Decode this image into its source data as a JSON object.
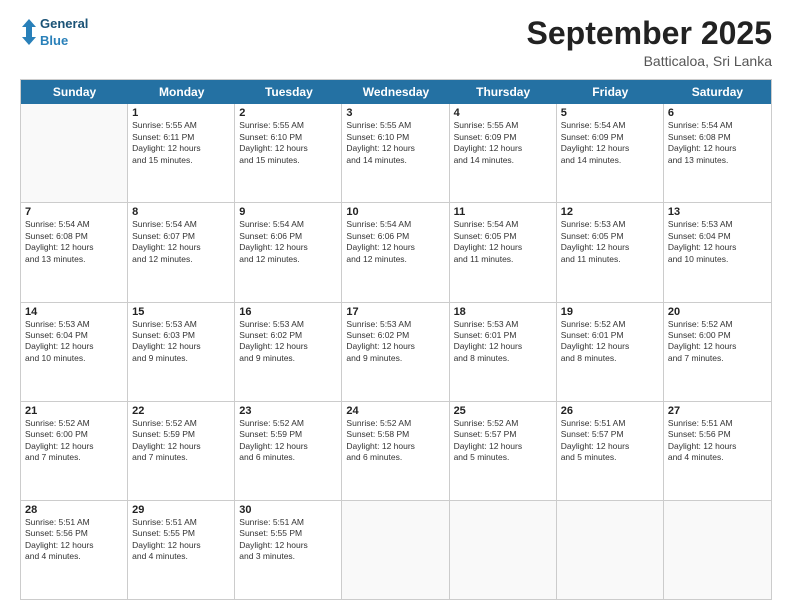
{
  "header": {
    "logo_line1": "General",
    "logo_line2": "Blue",
    "month_title": "September 2025",
    "location": "Batticaloa, Sri Lanka"
  },
  "days_of_week": [
    "Sunday",
    "Monday",
    "Tuesday",
    "Wednesday",
    "Thursday",
    "Friday",
    "Saturday"
  ],
  "weeks": [
    [
      {
        "day": "",
        "info": ""
      },
      {
        "day": "1",
        "info": "Sunrise: 5:55 AM\nSunset: 6:11 PM\nDaylight: 12 hours\nand 15 minutes."
      },
      {
        "day": "2",
        "info": "Sunrise: 5:55 AM\nSunset: 6:10 PM\nDaylight: 12 hours\nand 15 minutes."
      },
      {
        "day": "3",
        "info": "Sunrise: 5:55 AM\nSunset: 6:10 PM\nDaylight: 12 hours\nand 14 minutes."
      },
      {
        "day": "4",
        "info": "Sunrise: 5:55 AM\nSunset: 6:09 PM\nDaylight: 12 hours\nand 14 minutes."
      },
      {
        "day": "5",
        "info": "Sunrise: 5:54 AM\nSunset: 6:09 PM\nDaylight: 12 hours\nand 14 minutes."
      },
      {
        "day": "6",
        "info": "Sunrise: 5:54 AM\nSunset: 6:08 PM\nDaylight: 12 hours\nand 13 minutes."
      }
    ],
    [
      {
        "day": "7",
        "info": "Sunrise: 5:54 AM\nSunset: 6:08 PM\nDaylight: 12 hours\nand 13 minutes."
      },
      {
        "day": "8",
        "info": "Sunrise: 5:54 AM\nSunset: 6:07 PM\nDaylight: 12 hours\nand 12 minutes."
      },
      {
        "day": "9",
        "info": "Sunrise: 5:54 AM\nSunset: 6:06 PM\nDaylight: 12 hours\nand 12 minutes."
      },
      {
        "day": "10",
        "info": "Sunrise: 5:54 AM\nSunset: 6:06 PM\nDaylight: 12 hours\nand 12 minutes."
      },
      {
        "day": "11",
        "info": "Sunrise: 5:54 AM\nSunset: 6:05 PM\nDaylight: 12 hours\nand 11 minutes."
      },
      {
        "day": "12",
        "info": "Sunrise: 5:53 AM\nSunset: 6:05 PM\nDaylight: 12 hours\nand 11 minutes."
      },
      {
        "day": "13",
        "info": "Sunrise: 5:53 AM\nSunset: 6:04 PM\nDaylight: 12 hours\nand 10 minutes."
      }
    ],
    [
      {
        "day": "14",
        "info": "Sunrise: 5:53 AM\nSunset: 6:04 PM\nDaylight: 12 hours\nand 10 minutes."
      },
      {
        "day": "15",
        "info": "Sunrise: 5:53 AM\nSunset: 6:03 PM\nDaylight: 12 hours\nand 9 minutes."
      },
      {
        "day": "16",
        "info": "Sunrise: 5:53 AM\nSunset: 6:02 PM\nDaylight: 12 hours\nand 9 minutes."
      },
      {
        "day": "17",
        "info": "Sunrise: 5:53 AM\nSunset: 6:02 PM\nDaylight: 12 hours\nand 9 minutes."
      },
      {
        "day": "18",
        "info": "Sunrise: 5:53 AM\nSunset: 6:01 PM\nDaylight: 12 hours\nand 8 minutes."
      },
      {
        "day": "19",
        "info": "Sunrise: 5:52 AM\nSunset: 6:01 PM\nDaylight: 12 hours\nand 8 minutes."
      },
      {
        "day": "20",
        "info": "Sunrise: 5:52 AM\nSunset: 6:00 PM\nDaylight: 12 hours\nand 7 minutes."
      }
    ],
    [
      {
        "day": "21",
        "info": "Sunrise: 5:52 AM\nSunset: 6:00 PM\nDaylight: 12 hours\nand 7 minutes."
      },
      {
        "day": "22",
        "info": "Sunrise: 5:52 AM\nSunset: 5:59 PM\nDaylight: 12 hours\nand 7 minutes."
      },
      {
        "day": "23",
        "info": "Sunrise: 5:52 AM\nSunset: 5:59 PM\nDaylight: 12 hours\nand 6 minutes."
      },
      {
        "day": "24",
        "info": "Sunrise: 5:52 AM\nSunset: 5:58 PM\nDaylight: 12 hours\nand 6 minutes."
      },
      {
        "day": "25",
        "info": "Sunrise: 5:52 AM\nSunset: 5:57 PM\nDaylight: 12 hours\nand 5 minutes."
      },
      {
        "day": "26",
        "info": "Sunrise: 5:51 AM\nSunset: 5:57 PM\nDaylight: 12 hours\nand 5 minutes."
      },
      {
        "day": "27",
        "info": "Sunrise: 5:51 AM\nSunset: 5:56 PM\nDaylight: 12 hours\nand 4 minutes."
      }
    ],
    [
      {
        "day": "28",
        "info": "Sunrise: 5:51 AM\nSunset: 5:56 PM\nDaylight: 12 hours\nand 4 minutes."
      },
      {
        "day": "29",
        "info": "Sunrise: 5:51 AM\nSunset: 5:55 PM\nDaylight: 12 hours\nand 4 minutes."
      },
      {
        "day": "30",
        "info": "Sunrise: 5:51 AM\nSunset: 5:55 PM\nDaylight: 12 hours\nand 3 minutes."
      },
      {
        "day": "",
        "info": ""
      },
      {
        "day": "",
        "info": ""
      },
      {
        "day": "",
        "info": ""
      },
      {
        "day": "",
        "info": ""
      }
    ]
  ]
}
